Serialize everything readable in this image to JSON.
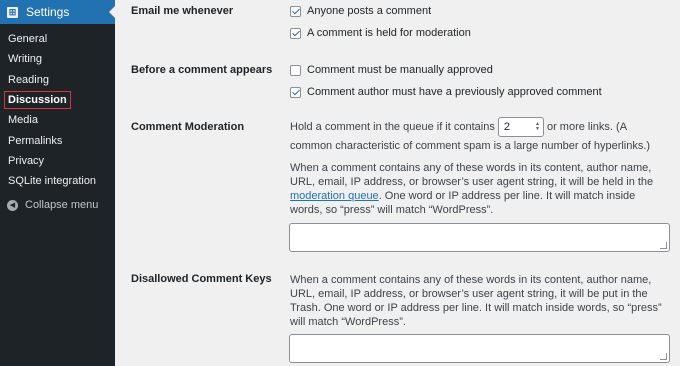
{
  "sidebar": {
    "header": "Settings",
    "items": [
      {
        "label": "General"
      },
      {
        "label": "Writing"
      },
      {
        "label": "Reading"
      },
      {
        "label": "Discussion"
      },
      {
        "label": "Media"
      },
      {
        "label": "Permalinks"
      },
      {
        "label": "Privacy"
      },
      {
        "label": "SQLite integration"
      }
    ],
    "active": "Discussion",
    "collapse_label": "Collapse menu"
  },
  "email_section": {
    "label": "Email me whenever",
    "options": [
      {
        "label": "Anyone posts a comment",
        "checked": true
      },
      {
        "label": "A comment is held for moderation",
        "checked": true
      }
    ]
  },
  "before_section": {
    "label": "Before a comment appears",
    "options": [
      {
        "label": "Comment must be manually approved",
        "checked": false
      },
      {
        "label": "Comment author must have a previously approved comment",
        "checked": true
      }
    ]
  },
  "moderation": {
    "label": "Comment Moderation",
    "hold_prefix": "Hold a comment in the queue if it contains",
    "links_value": "2",
    "hold_suffix": "or more links. (A common characteristic of comment spam is a large number of hyperlinks.)",
    "desc_before_link": "When a comment contains any of these words in its content, author name, URL, email, IP address, or browser’s user agent string, it will be held in the ",
    "link_text": "moderation queue",
    "desc_after_link": ". One word or IP address per line. It will match inside words, so “press” will match “WordPress”."
  },
  "disallowed": {
    "label": "Disallowed Comment Keys",
    "desc": "When a comment contains any of these words in its content, author name, URL, email, IP address, or browser’s user agent string, it will be put in the Trash. One word or IP address per line. It will match inside words, so “press” will match “WordPress”."
  },
  "colors": {
    "sidebar_bg": "#1d2327",
    "accent": "#2271b1",
    "active_outline": "#d63638",
    "page_bg": "#f0f0f1"
  }
}
